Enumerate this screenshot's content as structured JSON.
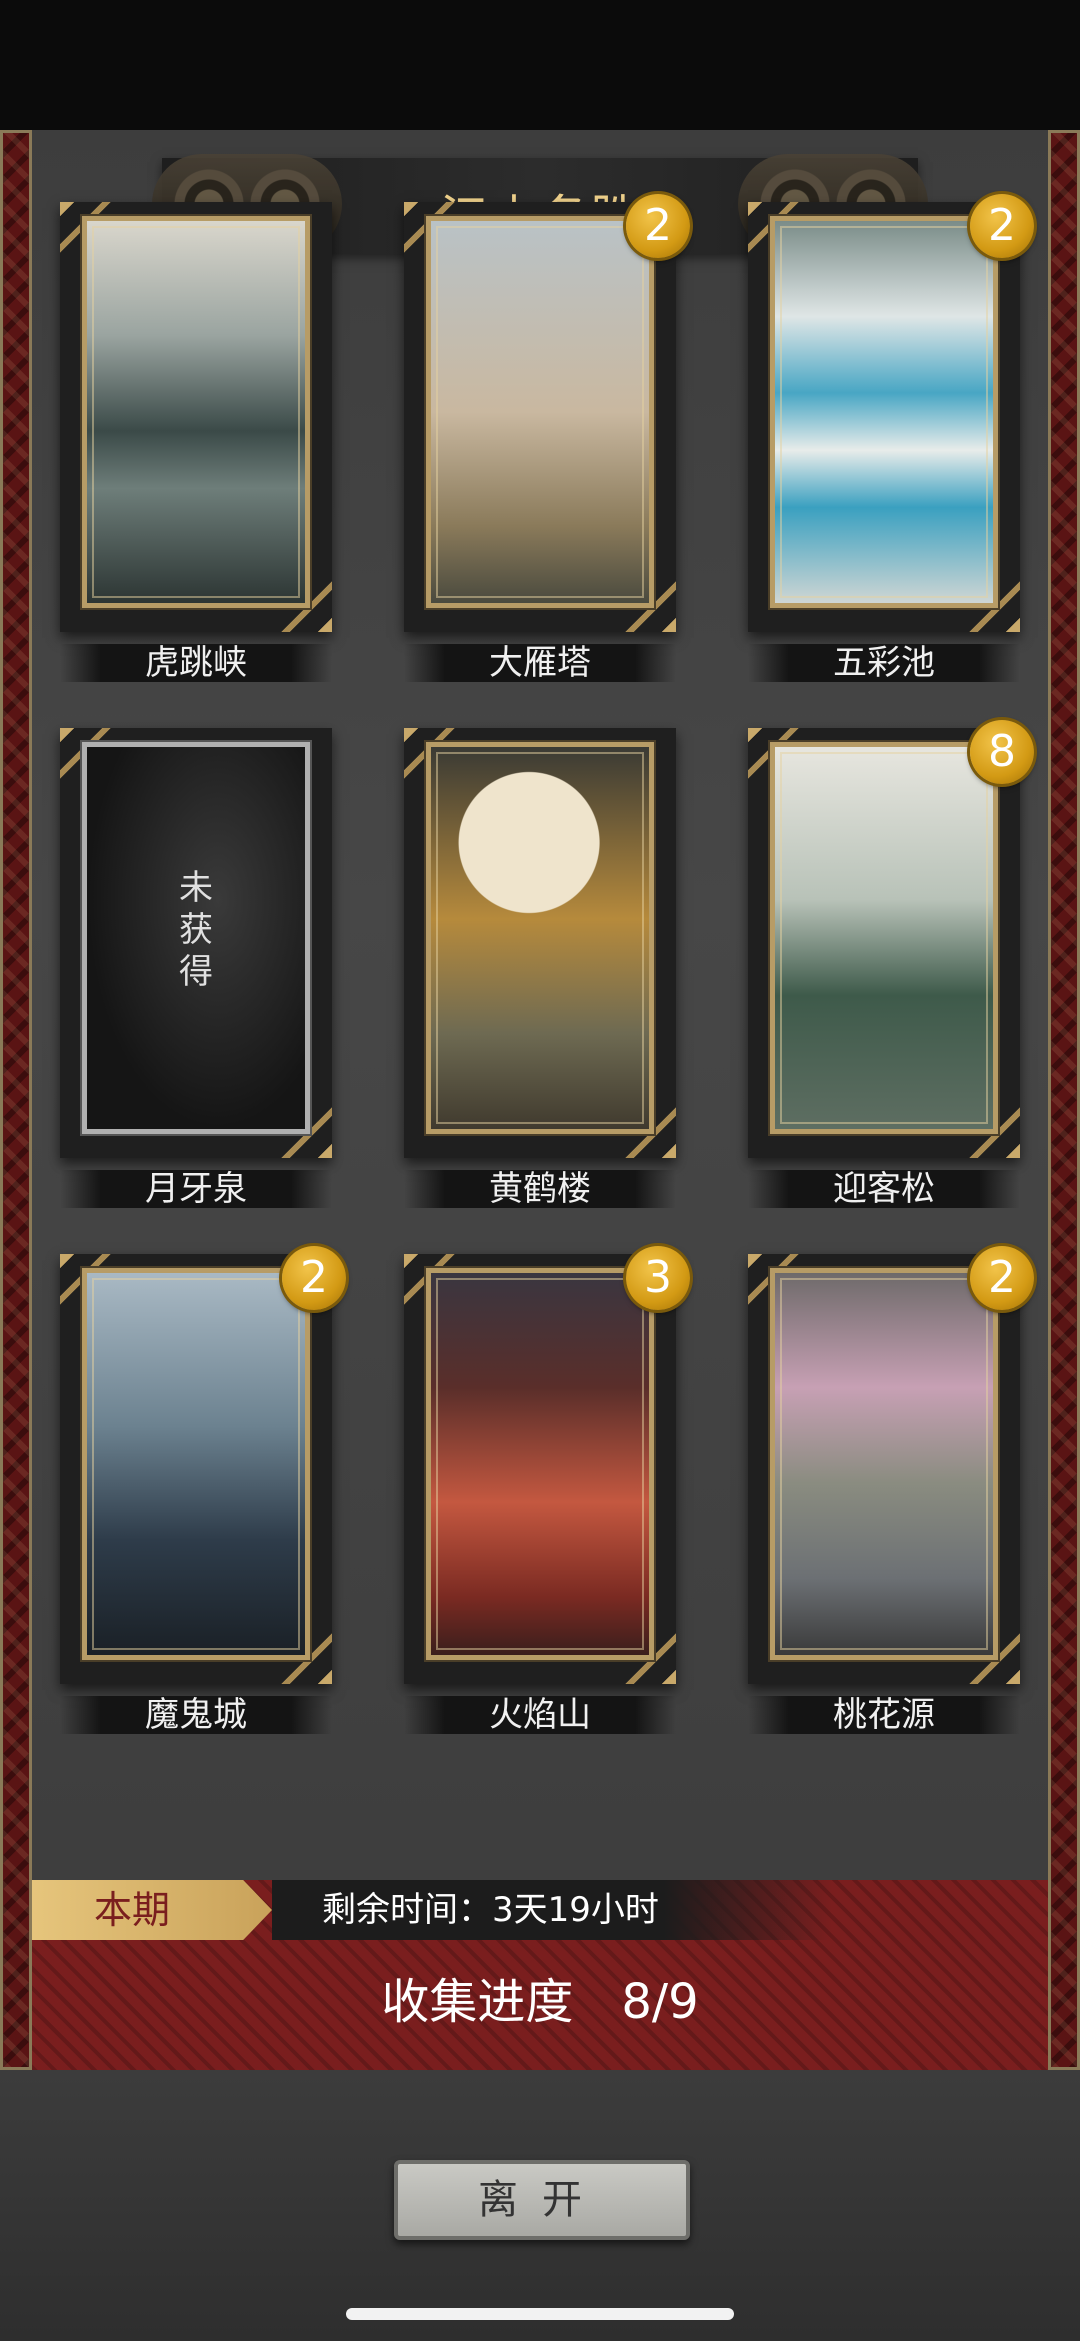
{
  "title": "江山名胜",
  "cards": [
    {
      "name": "虎跳峡",
      "badge": "",
      "art": "art-hutiao",
      "locked": false
    },
    {
      "name": "大雁塔",
      "badge": "2",
      "art": "art-dayan",
      "locked": false
    },
    {
      "name": "五彩池",
      "badge": "2",
      "art": "art-wucai",
      "locked": false
    },
    {
      "name": "月牙泉",
      "badge": "",
      "art": "art-yueya",
      "locked": true,
      "locked_text": "未获得"
    },
    {
      "name": "黄鹤楼",
      "badge": "",
      "art": "art-huanghe",
      "locked": false
    },
    {
      "name": "迎客松",
      "badge": "8",
      "art": "art-yingke",
      "locked": false
    },
    {
      "name": "魔鬼城",
      "badge": "2",
      "art": "art-mogui",
      "locked": false
    },
    {
      "name": "火焰山",
      "badge": "3",
      "art": "art-huoyan",
      "locked": false
    },
    {
      "name": "桃花源",
      "badge": "2",
      "art": "art-taohua",
      "locked": false
    }
  ],
  "period": {
    "tag": "本期",
    "remaining": "剩余时间：3天19小时"
  },
  "progress": "收集进度　8/9",
  "leave_button": "离开",
  "colors": {
    "gold": "#f0d28c",
    "badge": "#d39a14",
    "panel_red": "#7a1e1e"
  }
}
